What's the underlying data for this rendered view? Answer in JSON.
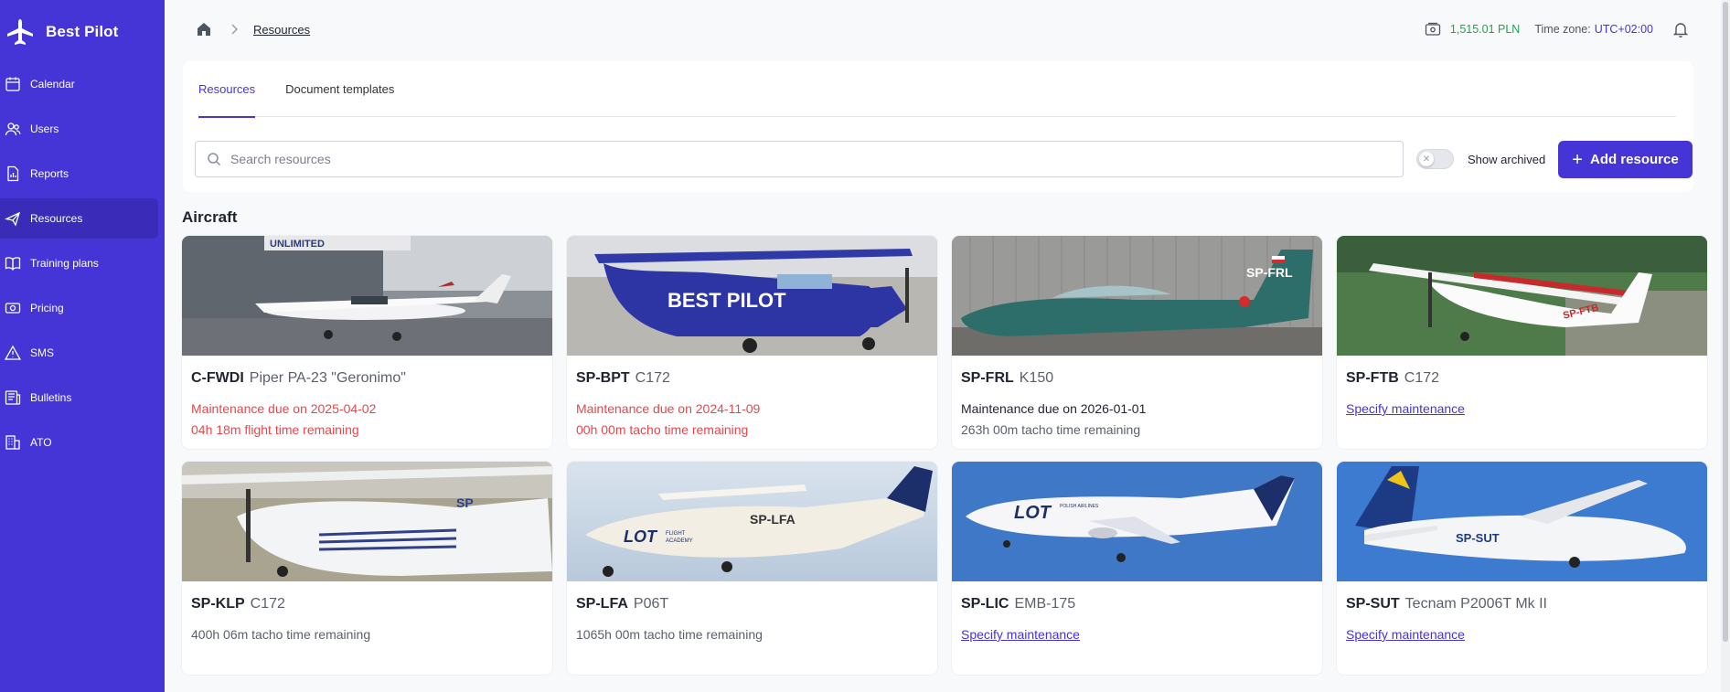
{
  "brand": {
    "name": "Best Pilot"
  },
  "sidebar": {
    "items": [
      {
        "label": "Calendar",
        "icon": "calendar-icon"
      },
      {
        "label": "Users",
        "icon": "users-icon"
      },
      {
        "label": "Reports",
        "icon": "reports-icon"
      },
      {
        "label": "Resources",
        "icon": "plane-icon",
        "active": true
      },
      {
        "label": "Training plans",
        "icon": "book-icon"
      },
      {
        "label": "Pricing",
        "icon": "pricing-icon"
      },
      {
        "label": "SMS",
        "icon": "warning-icon"
      },
      {
        "label": "Bulletins",
        "icon": "bulletins-icon"
      },
      {
        "label": "ATO",
        "icon": "building-icon"
      }
    ]
  },
  "breadcrumb": {
    "current": "Resources"
  },
  "header": {
    "balance": "1,515.01 PLN",
    "timezone_label": "Time zone:",
    "timezone_value": "UTC+02:00"
  },
  "tabs": [
    {
      "label": "Resources",
      "active": true
    },
    {
      "label": "Document templates",
      "active": false
    }
  ],
  "search": {
    "placeholder": "Search resources",
    "value": ""
  },
  "toggle": {
    "label": "Show archived",
    "checked": false
  },
  "add_button": {
    "label": "Add resource"
  },
  "section": {
    "title": "Aircraft"
  },
  "aircraft": [
    {
      "reg": "C-FWDI",
      "model": "Piper PA-23 \"Geronimo\"",
      "lines": [
        {
          "text": "Maintenance due on 2025-04-02",
          "style": "alert"
        },
        {
          "text": "04h 18m flight time remaining",
          "style": "alert"
        }
      ]
    },
    {
      "reg": "SP-BPT",
      "model": "C172",
      "lines": [
        {
          "text": "Maintenance due on 2024-11-09",
          "style": "alert"
        },
        {
          "text": "00h 00m tacho time remaining",
          "style": "alert"
        }
      ]
    },
    {
      "reg": "SP-FRL",
      "model": "K150",
      "lines": [
        {
          "text": "Maintenance due on 2026-01-01",
          "style": "normal"
        },
        {
          "text": "263h 00m tacho time remaining",
          "style": "muted"
        }
      ]
    },
    {
      "reg": "SP-FTB",
      "model": "C172",
      "lines": [
        {
          "text": "Specify maintenance",
          "style": "link"
        }
      ]
    },
    {
      "reg": "SP-KLP",
      "model": "C172",
      "lines": [
        {
          "text": "400h 06m tacho time remaining",
          "style": "muted"
        }
      ]
    },
    {
      "reg": "SP-LFA",
      "model": "P06T",
      "lines": [
        {
          "text": "1065h 00m tacho time remaining",
          "style": "muted"
        }
      ]
    },
    {
      "reg": "SP-LIC",
      "model": "EMB-175",
      "lines": [
        {
          "text": "Specify maintenance",
          "style": "link"
        }
      ]
    },
    {
      "reg": "SP-SUT",
      "model": "Tecnam P2006T Mk II",
      "lines": [
        {
          "text": "Specify maintenance",
          "style": "link"
        }
      ]
    }
  ],
  "photo_text": {
    "hangar_sign": "UNLIMITED",
    "bpt_livery": "BEST PILOT",
    "frl_tail": "SP-FRL",
    "ftb_wing": "SP-FTB",
    "lfa_brand": "LOT",
    "lfa_sub1": "FLIGHT",
    "lfa_sub2": "ACADEMY",
    "lfa_reg": "SP-LFA",
    "lic_brand": "LOT",
    "lic_sub": "POLISH AIRLINES",
    "sut_reg": "SP-SUT",
    "klp_tail": "SP"
  },
  "colors": {
    "accent": "#4535d6",
    "alert": "#e5484d",
    "balance": "#22a24a"
  }
}
